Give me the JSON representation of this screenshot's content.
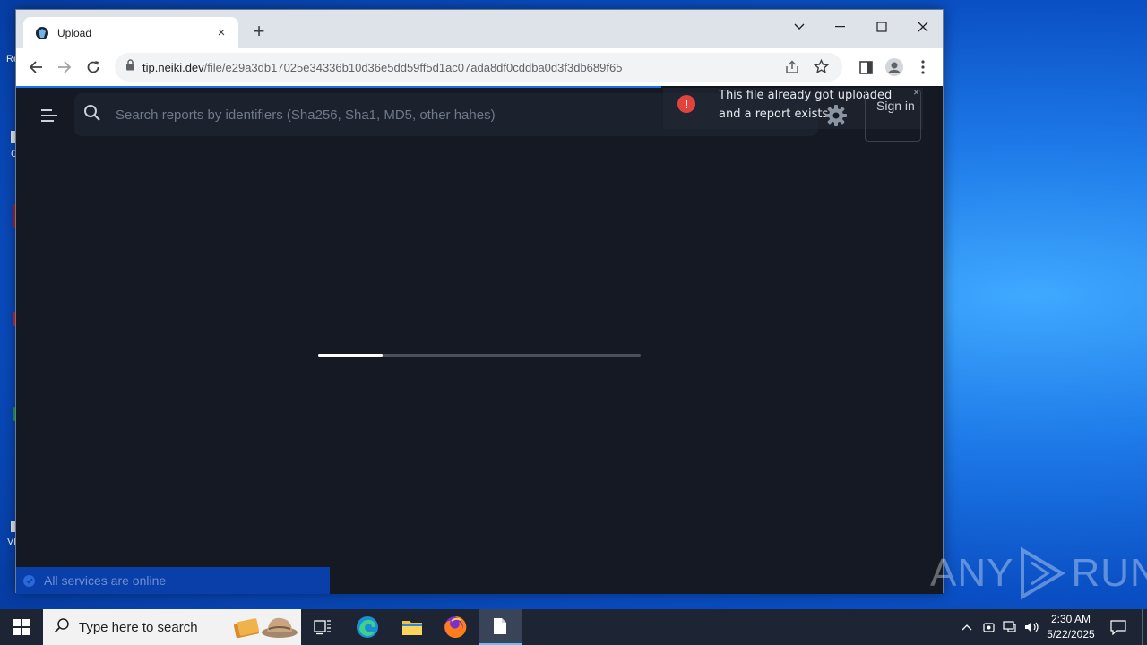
{
  "desktop": {
    "partial_labels": [
      "Re",
      "C",
      "Vl"
    ]
  },
  "browser": {
    "tab": {
      "title": "Upload",
      "close_glyph": "×"
    },
    "new_tab_glyph": "+",
    "address": {
      "host": "tip.neiki.dev",
      "path": "/file/e29a3db17025e34336b10d36e5dd59ff5d1ac07ada8df0cddba0d3f3db689f65"
    }
  },
  "page": {
    "search_placeholder": "Search reports by identifiers (Sha256, Sha1, MD5, other hahes)",
    "sign_in_label": "Sign in",
    "toast": {
      "message": "This file already got uploaded and a report exists!",
      "close_glyph": "×"
    },
    "loading_progress": 0.2,
    "status_text": "All services are online"
  },
  "watermark": {
    "left": "ANY",
    "right": "RUN"
  },
  "taskbar": {
    "search_placeholder": "Type here to search",
    "time": "2:30 AM",
    "date": "5/22/2025"
  },
  "colors": {
    "accent": "#1a73e8",
    "toast_error": "#e0443c",
    "status_bar": "#0a3ea8"
  }
}
